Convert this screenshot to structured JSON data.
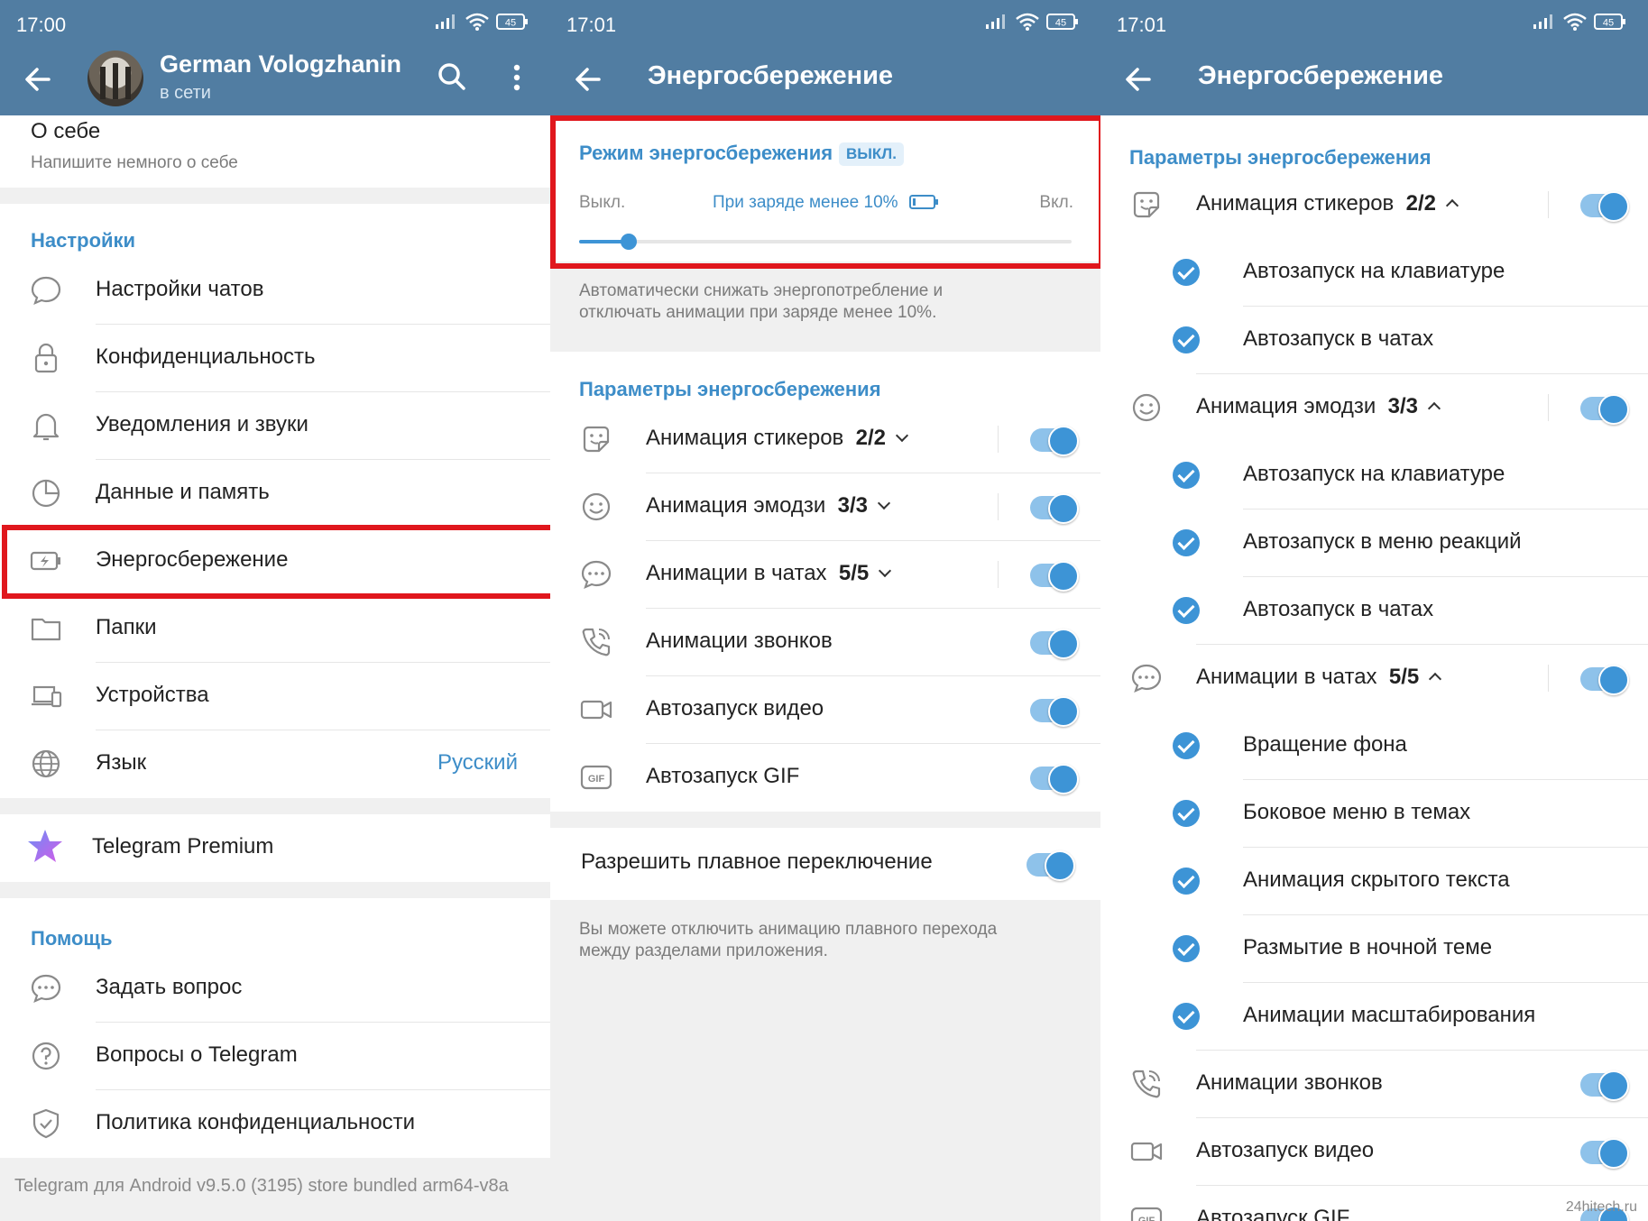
{
  "colors": {
    "appbar": "#517da2",
    "accent": "#3d8dc8",
    "toggle_track": "#8ec2ea",
    "toggle_thumb": "#3d94d6",
    "highlight": "#e0171d"
  },
  "screen1": {
    "time": "17:00",
    "battery": "45",
    "profile_name": "German Vologzhanin",
    "profile_status": "в сети",
    "about_title": "О себе",
    "about_hint": "Напишите немного о себе",
    "settings_title": "Настройки",
    "settings_items": [
      {
        "label": "Настройки чатов",
        "icon": "chat-bubble-icon"
      },
      {
        "label": "Конфиденциальность",
        "icon": "lock-icon"
      },
      {
        "label": "Уведомления и звуки",
        "icon": "bell-icon"
      },
      {
        "label": "Данные и память",
        "icon": "pie-chart-icon"
      },
      {
        "label": "Энергосбережение",
        "icon": "battery-bolt-icon"
      },
      {
        "label": "Папки",
        "icon": "folder-icon"
      },
      {
        "label": "Устройства",
        "icon": "devices-icon"
      },
      {
        "label": "Язык",
        "icon": "globe-icon",
        "value": "Русский"
      }
    ],
    "premium_label": "Telegram Premium",
    "help_title": "Помощь",
    "help_items": [
      {
        "label": "Задать вопрос",
        "icon": "chat-dots-icon"
      },
      {
        "label": "Вопросы о Telegram",
        "icon": "question-icon"
      },
      {
        "label": "Политика конфиденциальности",
        "icon": "shield-check-icon"
      }
    ],
    "version": "Telegram для Android v9.5.0 (3195) store bundled arm64-v8a"
  },
  "screen2": {
    "time": "17:01",
    "battery": "45",
    "title": "Энергосбережение",
    "mode_title": "Режим энергосбережения",
    "mode_badge": "ВЫКЛ.",
    "slider_off": "Выкл.",
    "slider_mid": "При заряде менее 10%",
    "slider_on": "Вкл.",
    "slider_value_fraction": 0.1,
    "mode_desc_1": "Автоматически снижать энергопотребление и",
    "mode_desc_2": "отключать анимации при заряде менее 10%.",
    "params_title": "Параметры энергосбережения",
    "params": [
      {
        "label": "Анимация стикеров",
        "count": "2/2",
        "icon": "sticker-icon",
        "expandable": true
      },
      {
        "label": "Анимация эмодзи",
        "count": "3/3",
        "icon": "smile-icon",
        "expandable": true
      },
      {
        "label": "Анимации в чатах",
        "count": "5/5",
        "icon": "chat-dots-icon",
        "expandable": true
      },
      {
        "label": "Анимации звонков",
        "count": "",
        "icon": "phone-icon",
        "expandable": false
      },
      {
        "label": "Автозапуск видео",
        "count": "",
        "icon": "video-icon",
        "expandable": false
      },
      {
        "label": "Автозапуск GIF",
        "count": "",
        "icon": "gif-icon",
        "expandable": false
      }
    ],
    "smooth_label": "Разрешить плавное переключение",
    "smooth_desc_1": "Вы можете отключить анимацию плавного перехода",
    "smooth_desc_2": "между разделами приложения."
  },
  "screen3": {
    "time": "17:01",
    "battery": "45",
    "title": "Энергосбережение",
    "params_title": "Параметры энергосбережения",
    "groups": [
      {
        "label": "Анимация стикеров",
        "count": "2/2",
        "icon": "sticker-icon",
        "items": [
          "Автозапуск на клавиатуре",
          "Автозапуск в чатах"
        ]
      },
      {
        "label": "Анимация эмодзи",
        "count": "3/3",
        "icon": "smile-icon",
        "items": [
          "Автозапуск на клавиатуре",
          "Автозапуск в меню реакций",
          "Автозапуск в чатах"
        ]
      },
      {
        "label": "Анимации в чатах",
        "count": "5/5",
        "icon": "chat-dots-icon",
        "items": [
          "Вращение фона",
          "Боковое меню в темах",
          "Анимация скрытого текста",
          "Размытие в ночной теме",
          "Анимации масштабирования"
        ]
      }
    ],
    "calls_label": "Анимации звонков",
    "video_label": "Автозапуск видео",
    "gif_label": "Автозапуск GIF",
    "watermark": "24hitech.ru"
  }
}
